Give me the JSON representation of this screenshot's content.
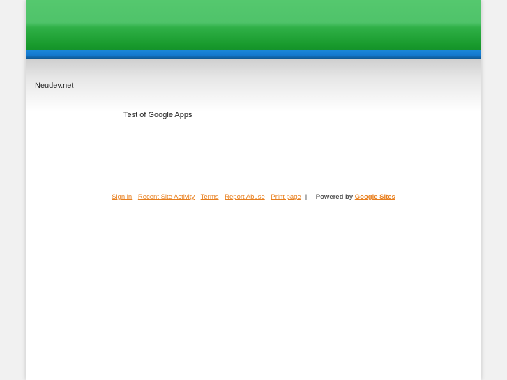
{
  "site": {
    "title": "Neudev.net"
  },
  "main": {
    "text": "Test of Google Apps"
  },
  "footer": {
    "links": {
      "sign_in": "Sign in",
      "recent_activity": "Recent Site Activity",
      "terms": "Terms",
      "report_abuse": "Report Abuse",
      "print_page": "Print page"
    },
    "separator": "|",
    "powered_by": "Powered by",
    "google_sites": "Google Sites"
  },
  "colors": {
    "banner_green": "#2fb047",
    "stripe_blue": "#1479cf",
    "link_orange": "#e87f1e"
  }
}
